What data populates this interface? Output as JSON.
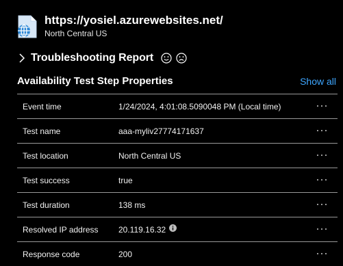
{
  "header": {
    "url": "https://yosiel.azurewebsites.net/",
    "region": "North Central US",
    "icon": "globe-document-icon"
  },
  "report": {
    "title": "Troubleshooting Report",
    "feedback_icons": [
      "smile-icon",
      "frown-icon"
    ]
  },
  "section": {
    "title": "Availability Test Step Properties",
    "show_all": "Show all"
  },
  "properties": [
    {
      "label": "Event time",
      "value": "1/24/2024, 4:01:08.5090048 PM (Local time)"
    },
    {
      "label": "Test name",
      "value": "aaa-myliv27774171637"
    },
    {
      "label": "Test location",
      "value": "North Central US"
    },
    {
      "label": "Test success",
      "value": "true"
    },
    {
      "label": "Test duration",
      "value": "138 ms"
    },
    {
      "label": "Resolved IP address",
      "value": "20.119.16.32",
      "info": true
    },
    {
      "label": "Response code",
      "value": "200"
    }
  ],
  "colors": {
    "accent": "#3ea6ff",
    "background": "#000000",
    "divider": "#9a9a9a"
  }
}
